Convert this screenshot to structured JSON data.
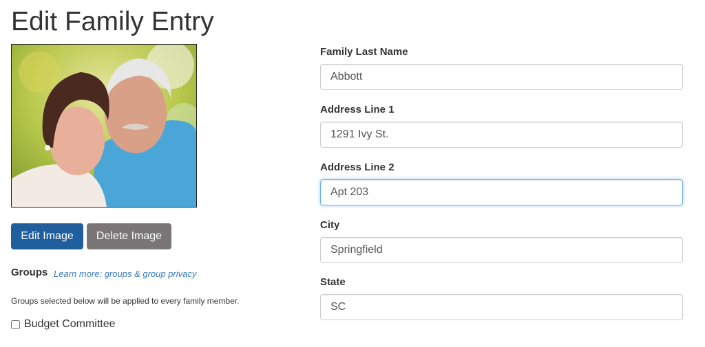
{
  "page": {
    "title": "Edit Family Entry"
  },
  "photo": {
    "alt": "Family photo of an older couple smiling outdoors"
  },
  "buttons": {
    "edit_image": "Edit Image",
    "delete_image": "Delete Image",
    "edit_color": "#1f5f9e",
    "delete_color": "#7a7677"
  },
  "groups": {
    "heading": "Groups",
    "learn_more_link": "Learn more: groups & group privacy",
    "help_text": "Groups selected below will be applied to every family member.",
    "items": [
      {
        "label": "Budget Committee",
        "checked": false
      }
    ]
  },
  "form": {
    "fields": [
      {
        "label": "Family Last Name",
        "value": "Abbott",
        "focused": false
      },
      {
        "label": "Address Line 1",
        "value": "1291 Ivy St.",
        "focused": false
      },
      {
        "label": "Address Line 2",
        "value": "Apt 203",
        "focused": true
      },
      {
        "label": "City",
        "value": "Springfield",
        "focused": false
      },
      {
        "label": "State",
        "value": "SC",
        "focused": false
      }
    ]
  }
}
